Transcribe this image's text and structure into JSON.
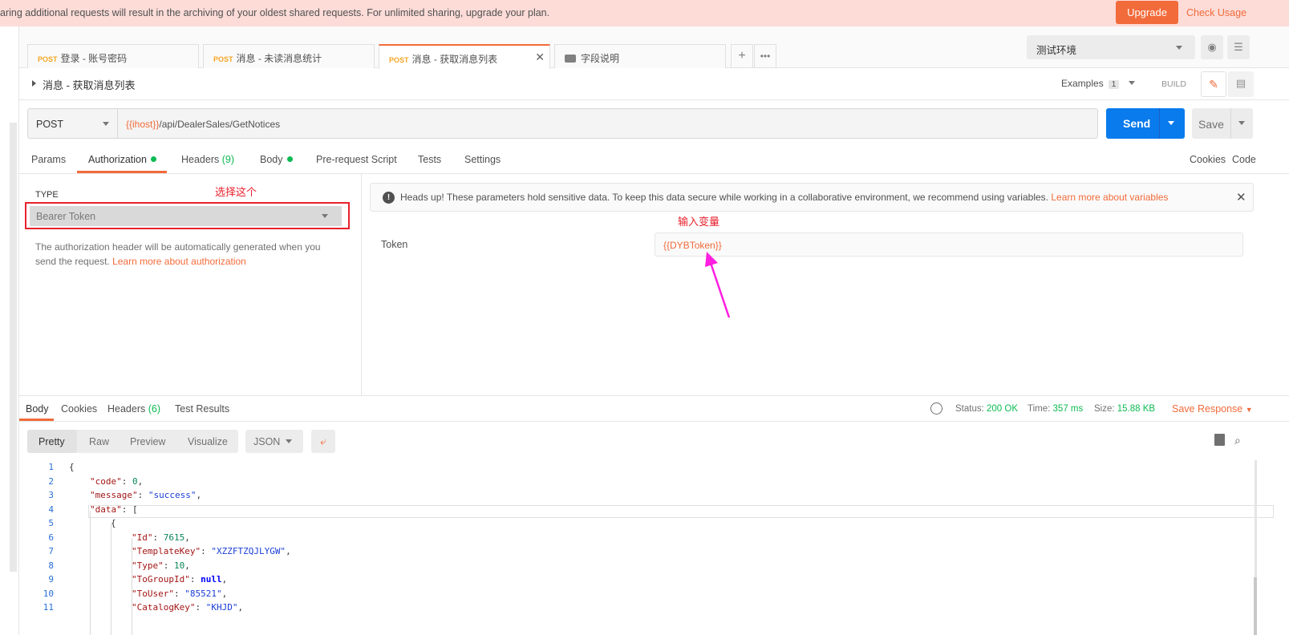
{
  "banner": {
    "text": "aring additional requests will result in the archiving of your oldest shared requests. For unlimited sharing, upgrade your plan.",
    "upgrade_label": "Upgrade",
    "check_usage_label": "Check Usage"
  },
  "tabs": [
    {
      "method": "POST",
      "title": "登录 - 账号密码"
    },
    {
      "method": "POST",
      "title": "消息 - 未读消息统计"
    },
    {
      "method": "POST",
      "title": "消息 - 获取消息列表"
    },
    {
      "method": "",
      "title": "字段说明"
    }
  ],
  "environment": {
    "selected": "测试环境"
  },
  "request": {
    "title": "消息 - 获取消息列表",
    "examples_label": "Examples",
    "examples_count": "1",
    "build_label": "BUILD",
    "method": "POST",
    "url_var": "{{ihost}}",
    "url_path": "/api/DealerSales/GetNotices",
    "send_label": "Send",
    "save_label": "Save"
  },
  "request_tabs": {
    "params": "Params",
    "authorization": "Authorization",
    "headers": "Headers",
    "headers_count": "(9)",
    "body": "Body",
    "prerequest": "Pre-request Script",
    "tests": "Tests",
    "settings": "Settings",
    "cookies": "Cookies",
    "code": "Code"
  },
  "auth": {
    "type_label": "TYPE",
    "type_value": "Bearer Token",
    "desc": "The authorization header will be automatically generated when you send the request.",
    "desc_link": "Learn more about authorization",
    "notice_text": "Heads up! These parameters hold sensitive data. To keep this data secure while working in a collaborative environment, we recommend using variables.",
    "notice_link": "Learn more about variables",
    "token_label": "Token",
    "token_value": "{{DYBToken}}"
  },
  "annotations": {
    "select_this": "选择这个",
    "input_variable": "输入变量"
  },
  "response": {
    "tabs": {
      "body": "Body",
      "cookies": "Cookies",
      "headers": "Headers",
      "headers_count": "(6)",
      "test_results": "Test Results"
    },
    "status_label": "Status:",
    "status_value": "200 OK",
    "time_label": "Time:",
    "time_value": "357 ms",
    "size_label": "Size:",
    "size_value": "15.88 KB",
    "save_response_label": "Save Response",
    "views": [
      "Pretty",
      "Raw",
      "Preview",
      "Visualize"
    ],
    "format": "JSON"
  },
  "code_lines": [
    {
      "n": "1",
      "indent": 0,
      "parts": [
        [
          "p",
          "{"
        ]
      ]
    },
    {
      "n": "2",
      "indent": 1,
      "parts": [
        [
          "k",
          "\"code\""
        ],
        [
          "p",
          ": "
        ],
        [
          "n",
          "0"
        ],
        [
          "p",
          ","
        ]
      ]
    },
    {
      "n": "3",
      "indent": 1,
      "parts": [
        [
          "k",
          "\"message\""
        ],
        [
          "p",
          ": "
        ],
        [
          "s",
          "\"success\""
        ],
        [
          "p",
          ","
        ]
      ]
    },
    {
      "n": "4",
      "indent": 1,
      "parts": [
        [
          "k",
          "\"data\""
        ],
        [
          "p",
          ": ["
        ]
      ]
    },
    {
      "n": "5",
      "indent": 2,
      "parts": [
        [
          "p",
          "{"
        ]
      ]
    },
    {
      "n": "6",
      "indent": 3,
      "parts": [
        [
          "k",
          "\"Id\""
        ],
        [
          "p",
          ": "
        ],
        [
          "n",
          "7615"
        ],
        [
          "p",
          ","
        ]
      ]
    },
    {
      "n": "7",
      "indent": 3,
      "parts": [
        [
          "k",
          "\"TemplateKey\""
        ],
        [
          "p",
          ": "
        ],
        [
          "s",
          "\"XZZFTZQJLYGW\""
        ],
        [
          "p",
          ","
        ]
      ]
    },
    {
      "n": "8",
      "indent": 3,
      "parts": [
        [
          "k",
          "\"Type\""
        ],
        [
          "p",
          ": "
        ],
        [
          "n",
          "10"
        ],
        [
          "p",
          ","
        ]
      ]
    },
    {
      "n": "9",
      "indent": 3,
      "parts": [
        [
          "k",
          "\"ToGroupId\""
        ],
        [
          "p",
          ": "
        ],
        [
          "kw",
          "null"
        ],
        [
          "p",
          ","
        ]
      ]
    },
    {
      "n": "10",
      "indent": 3,
      "parts": [
        [
          "k",
          "\"ToUser\""
        ],
        [
          "p",
          ": "
        ],
        [
          "s",
          "\"85521\""
        ],
        [
          "p",
          ","
        ]
      ]
    },
    {
      "n": "11",
      "indent": 3,
      "parts": [
        [
          "k",
          "\"CatalogKey\""
        ],
        [
          "p",
          ": "
        ],
        [
          "s",
          "\"KHJD\""
        ],
        [
          "p",
          ","
        ]
      ]
    }
  ]
}
